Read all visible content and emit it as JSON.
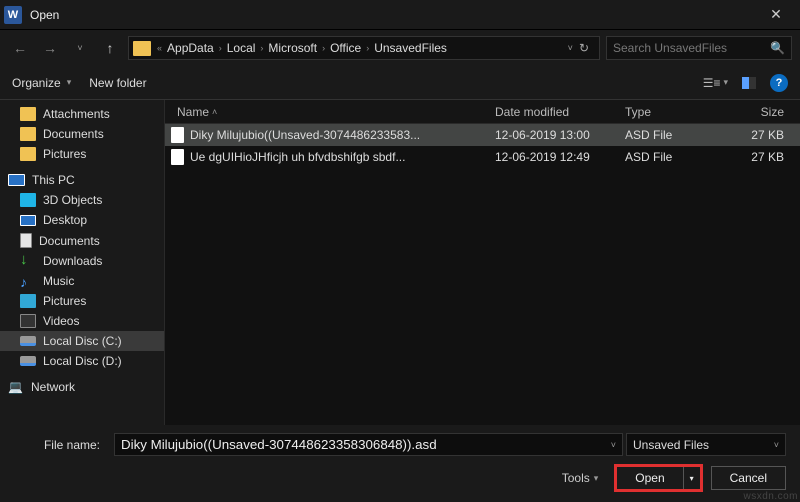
{
  "titlebar": {
    "app_glyph": "W",
    "title": "Open"
  },
  "nav": {
    "breadcrumb": [
      "AppData",
      "Local",
      "Microsoft",
      "Office",
      "UnsavedFiles"
    ],
    "search_placeholder": "Search UnsavedFiles"
  },
  "toolbar": {
    "organize": "Organize",
    "new_folder": "New folder"
  },
  "sidebar": {
    "quick": [
      {
        "label": "Attachments",
        "icon": "folder"
      },
      {
        "label": "Documents",
        "icon": "folder"
      },
      {
        "label": "Pictures",
        "icon": "folder"
      }
    ],
    "thispc_label": "This PC",
    "thispc": [
      {
        "label": "3D Objects",
        "icon": "3d"
      },
      {
        "label": "Desktop",
        "icon": "desk"
      },
      {
        "label": "Documents",
        "icon": "doc"
      },
      {
        "label": "Downloads",
        "icon": "dl"
      },
      {
        "label": "Music",
        "icon": "music"
      },
      {
        "label": "Pictures",
        "icon": "pic"
      },
      {
        "label": "Videos",
        "icon": "vid"
      },
      {
        "label": "Local Disc (C:)",
        "icon": "disk",
        "selected": true
      },
      {
        "label": "Local Disc (D:)",
        "icon": "disk"
      }
    ],
    "network_label": "Network"
  },
  "columns": {
    "name": "Name",
    "date": "Date modified",
    "type": "Type",
    "size": "Size"
  },
  "files": [
    {
      "name": "Diky Milujubio((Unsaved-3074486233583...",
      "date": "12-06-2019 13:00",
      "type": "ASD File",
      "size": "27 KB",
      "selected": true
    },
    {
      "name": "Ue dgUIHioJHficjh uh bfvdbshifgb sbdf...",
      "date": "12-06-2019 12:49",
      "type": "ASD File",
      "size": "27 KB",
      "selected": false
    }
  ],
  "footer": {
    "filename_label": "File name:",
    "filename_value": "Diky Milujubio((Unsaved-307448623358306848)).asd",
    "filter": "Unsaved Files",
    "tools": "Tools",
    "open": "Open",
    "cancel": "Cancel"
  },
  "watermark": "wsxdn.com"
}
